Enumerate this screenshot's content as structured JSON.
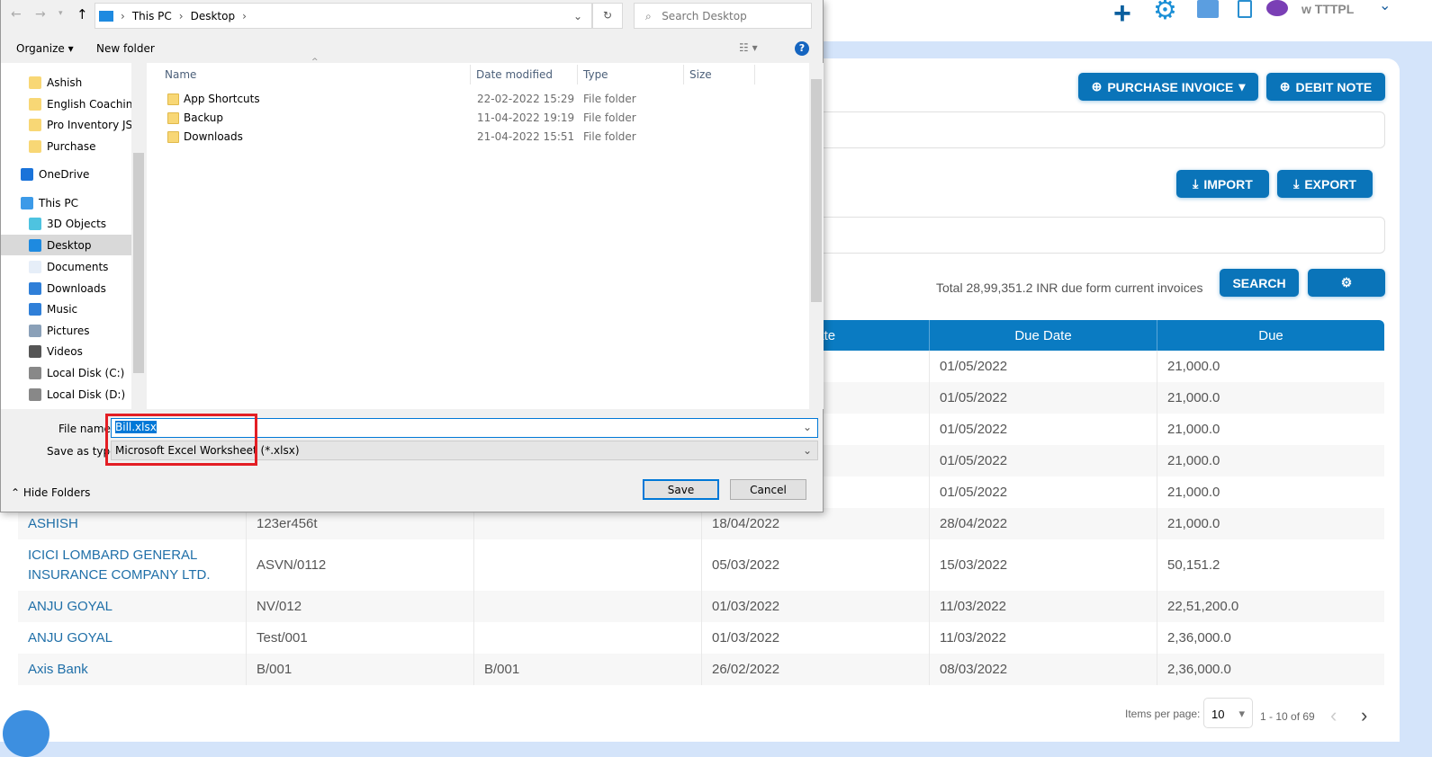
{
  "header": {
    "account": "w TTTPL",
    "icons": [
      "plus-icon",
      "gear-icon",
      "calculator-icon",
      "document-icon",
      "new-badge-icon",
      "chevron-down-icon"
    ]
  },
  "actions": {
    "purchase_invoice": "PURCHASE INVOICE",
    "debit_note": "DEBIT NOTE",
    "import": "IMPORT",
    "export": "EXPORT",
    "search": "SEARCH"
  },
  "summary": "Total 28,99,351.2 INR due form current invoices",
  "table": {
    "headers": [
      "",
      "",
      "",
      "n Date",
      "Due Date",
      "Due"
    ],
    "rows": [
      [
        "",
        "",
        "",
        "",
        "01/05/2022",
        "21,000.0"
      ],
      [
        "",
        "",
        "",
        "",
        "01/05/2022",
        "21,000.0"
      ],
      [
        "",
        "",
        "",
        "",
        "01/05/2022",
        "21,000.0"
      ],
      [
        "",
        "",
        "",
        "",
        "01/05/2022",
        "21,000.0"
      ],
      [
        "",
        "",
        "",
        "",
        "01/05/2022",
        "21,000.0"
      ],
      [
        "ASHISH",
        "123er456t",
        "",
        "18/04/2022",
        "28/04/2022",
        "21,000.0"
      ],
      [
        "ICICI LOMBARD GENERAL INSURANCE COMPANY LTD.",
        "ASVN/0112",
        "",
        "05/03/2022",
        "15/03/2022",
        "50,151.2"
      ],
      [
        "ANJU GOYAL",
        "NV/012",
        "",
        "01/03/2022",
        "11/03/2022",
        "22,51,200.0"
      ],
      [
        "ANJU GOYAL",
        "Test/001",
        "",
        "01/03/2022",
        "11/03/2022",
        "2,36,000.0"
      ],
      [
        "Axis Bank",
        "B/001",
        "B/001",
        "26/02/2022",
        "08/03/2022",
        "2,36,000.0"
      ]
    ]
  },
  "pagination": {
    "label": "Items per page:",
    "per_page": "10",
    "range": "1 - 10 of 69"
  },
  "dialog": {
    "breadcrumb": [
      "This PC",
      "Desktop"
    ],
    "search_placeholder": "Search Desktop",
    "organize": "Organize ▾",
    "new_folder": "New folder",
    "nav": [
      {
        "label": "Ashish",
        "icon": "folder-icon"
      },
      {
        "label": "English Coaching",
        "icon": "folder-icon"
      },
      {
        "label": "Pro Inventory JSON",
        "icon": "folder-icon"
      },
      {
        "label": "Purchase",
        "icon": "folder-icon"
      },
      {
        "label": "OneDrive",
        "icon": "cloud-icon"
      },
      {
        "label": "This PC",
        "icon": "computer-icon"
      },
      {
        "label": "3D Objects",
        "icon": "cube-icon"
      },
      {
        "label": "Desktop",
        "icon": "desktop-icon",
        "selected": true
      },
      {
        "label": "Documents",
        "icon": "document-icon"
      },
      {
        "label": "Downloads",
        "icon": "download-icon"
      },
      {
        "label": "Music",
        "icon": "music-icon"
      },
      {
        "label": "Pictures",
        "icon": "picture-icon"
      },
      {
        "label": "Videos",
        "icon": "video-icon"
      },
      {
        "label": "Local Disk (C:)",
        "icon": "drive-icon"
      },
      {
        "label": "Local Disk (D:)",
        "icon": "drive-icon"
      }
    ],
    "columns": [
      "Name",
      "Date modified",
      "Type",
      "Size"
    ],
    "files": [
      {
        "name": "App Shortcuts",
        "date": "22-02-2022 15:29",
        "type": "File folder"
      },
      {
        "name": "Backup",
        "date": "11-04-2022 19:19",
        "type": "File folder"
      },
      {
        "name": "Downloads",
        "date": "21-04-2022 15:51",
        "type": "File folder"
      }
    ],
    "file_name_label": "File name:",
    "file_name": "Bill.xlsx",
    "save_type_label": "Save as type:",
    "save_type": "Microsoft Excel Worksheet (*.xlsx)",
    "hide_folders": "Hide Folders",
    "save": "Save",
    "cancel": "Cancel",
    "highlight_color": "#e31e24"
  }
}
